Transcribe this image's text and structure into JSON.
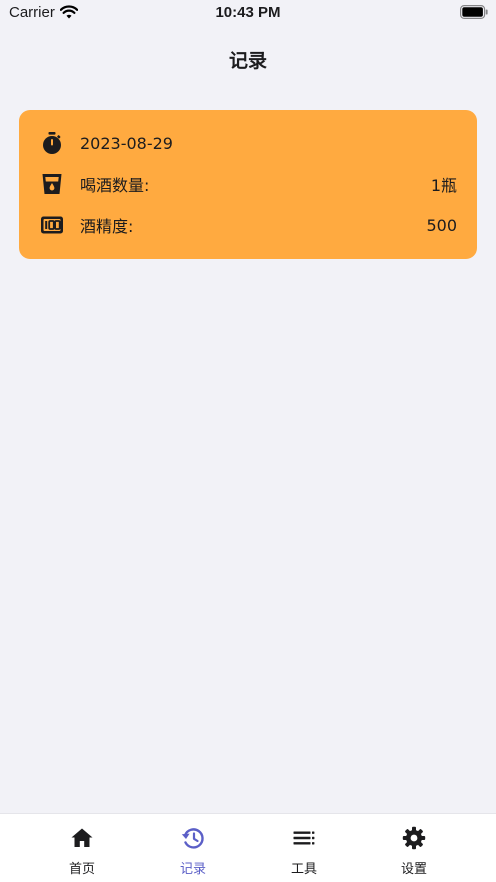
{
  "status_bar": {
    "carrier": "Carrier",
    "time": "10:43 PM"
  },
  "nav": {
    "title": "记录"
  },
  "record": {
    "date": "2023-08-29",
    "count_label": "喝酒数量:",
    "count_value": "1瓶",
    "abv_label": "酒精度:",
    "abv_value": "500"
  },
  "tabs": [
    {
      "label": "首页",
      "icon": "home-icon"
    },
    {
      "label": "记录",
      "icon": "history-icon",
      "active": true
    },
    {
      "label": "工具",
      "icon": "list-icon"
    },
    {
      "label": "设置",
      "icon": "gear-icon"
    }
  ],
  "colors": {
    "card": "#ffaa40",
    "accent": "#5b5fc7",
    "background": "#f2f2f7"
  }
}
